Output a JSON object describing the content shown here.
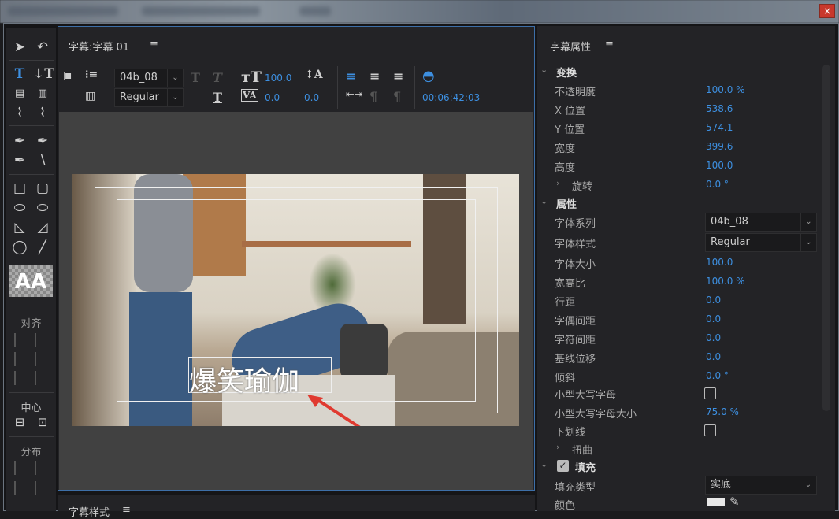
{
  "window": {
    "close_label": "×"
  },
  "tools": {
    "align_label": "对齐",
    "center_label": "中心",
    "distribute_label": "分布",
    "style_sample": "AA"
  },
  "title_panel": {
    "title": "字幕:字幕 01",
    "menu": "≡",
    "font_family": "04b_08",
    "font_style": "Regular",
    "font_size": "100.0",
    "kerning": "0.0",
    "leading": "0.0",
    "timecode": "00:06:42:03",
    "caption_text": "爆笑瑜伽"
  },
  "styles_panel": {
    "title": "字幕样式",
    "menu": "≡"
  },
  "properties": {
    "title": "字幕属性",
    "menu": "≡",
    "transform": {
      "label": "变换",
      "rows": [
        {
          "label": "不透明度",
          "value": "100.0 %"
        },
        {
          "label": "X 位置",
          "value": "538.6"
        },
        {
          "label": "Y 位置",
          "value": "574.1"
        },
        {
          "label": "宽度",
          "value": "399.6"
        },
        {
          "label": "高度",
          "value": "100.0"
        },
        {
          "label": "旋转",
          "value": "0.0 °"
        }
      ]
    },
    "attributes": {
      "label": "属性",
      "font_family_label": "字体系列",
      "font_family": "04b_08",
      "font_style_label": "字体样式",
      "font_style": "Regular",
      "rows": [
        {
          "label": "字体大小",
          "value": "100.0"
        },
        {
          "label": "宽高比",
          "value": "100.0 %"
        },
        {
          "label": "行距",
          "value": "0.0"
        },
        {
          "label": "字偶间距",
          "value": "0.0"
        },
        {
          "label": "字符间距",
          "value": "0.0"
        },
        {
          "label": "基线位移",
          "value": "0.0"
        },
        {
          "label": "倾斜",
          "value": "0.0 °"
        }
      ],
      "small_caps_label": "小型大写字母",
      "small_caps": false,
      "small_caps_size_label": "小型大写字母大小",
      "small_caps_size": "75.0 %",
      "underline_label": "下划线",
      "underline": false,
      "distort_label": "扭曲"
    },
    "fill": {
      "label": "填充",
      "enabled": true,
      "fill_type_label": "填充类型",
      "fill_type": "实底",
      "color_label": "颜色",
      "color": "#e8e8e8"
    }
  },
  "colors": {
    "accent": "#3d8fe0",
    "panel": "#232326",
    "canvas": "#414141",
    "focus_border": "#3d6fa8"
  }
}
